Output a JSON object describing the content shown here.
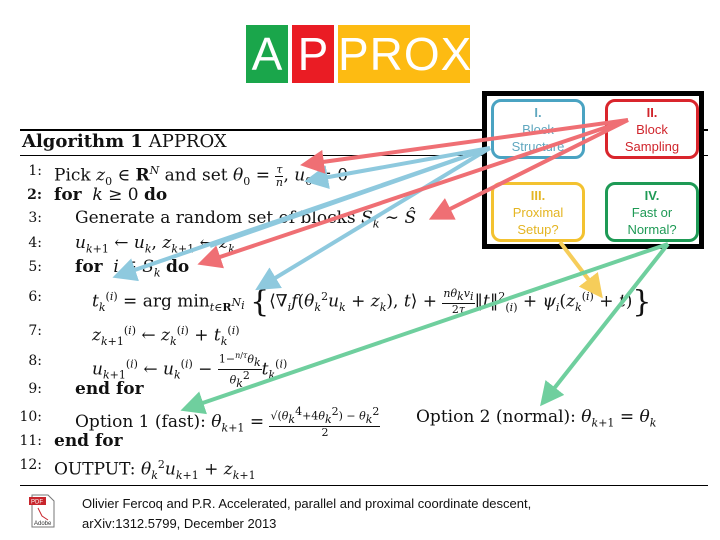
{
  "logo": {
    "tiles": [
      "A",
      "P",
      "PROX"
    ],
    "colors": {
      "a": "#1aa64b",
      "p": "#ea1c24",
      "prox": "#fdbb12"
    }
  },
  "quadrants": [
    {
      "numeral": "I.",
      "lines": [
        "Block",
        "Structure"
      ],
      "color": "#4aa3c2"
    },
    {
      "numeral": "II.",
      "lines": [
        "Block",
        "Sampling"
      ],
      "color": "#d9252c"
    },
    {
      "numeral": "III.",
      "lines": [
        "Proximal",
        "Setup?"
      ],
      "color": "#f3c230"
    },
    {
      "numeral": "IV.",
      "lines": [
        "Fast or",
        "Normal?"
      ],
      "color": "#1e9a55"
    }
  ],
  "algorithm": {
    "title_bold": "Algorithm 1",
    "title_name": "APPROX",
    "lines": [
      {
        "num": "1:",
        "text": "Pick z₀ ∈ Rᴺ and set θ₀ = τ/n, u₀ = 0"
      },
      {
        "num": "2:",
        "text": "for k ≥ 0 do"
      },
      {
        "num": "3:",
        "text": "Generate a random set of blocks Sₖ ∼ Ŝ"
      },
      {
        "num": "4:",
        "text": "uₖ₊₁ ← uₖ, zₖ₊₁ ← zₖ"
      },
      {
        "num": "5:",
        "text": "for i ∈ Sₖ do"
      },
      {
        "num": "6:",
        "text": "tₖ⁽ⁱ⁾ = arg min_{t∈R^{Nᵢ}} { ⟨∇ᵢf(θₖ²uₖ + zₖ), t⟩ + (nθₖvᵢ/2τ)‖t‖²₍ᵢ₎ + ψᵢ(zₖ⁽ⁱ⁾ + t) }"
      },
      {
        "num": "7:",
        "text": "zₖ₊₁⁽ⁱ⁾ ← zₖ⁽ⁱ⁾ + tₖ⁽ⁱ⁾"
      },
      {
        "num": "8:",
        "text": "uₖ₊₁⁽ⁱ⁾ ← uₖ⁽ⁱ⁾ − ((1 − (n/τ)θₖ)/θₖ²) tₖ⁽ⁱ⁾"
      },
      {
        "num": "9:",
        "text": "end for"
      },
      {
        "num": "10:",
        "text": "Option 1 (fast): θₖ₊₁ = (√(θₖ⁴ + 4θₖ²) − θₖ²)/2    Option 2 (normal): θₖ₊₁ = θₖ"
      },
      {
        "num": "11:",
        "text": "end for"
      },
      {
        "num": "12:",
        "text": "OUTPUT: θₖ²uₖ₊₁ + zₖ₊₁"
      }
    ],
    "parts": {
      "l1_pick": "Pick ",
      "l1_and": " and set ",
      "l2_for": "for",
      "l2_do": "do",
      "l3": "Generate a random set of blocks ",
      "l5_for": "for",
      "l5_do": "do",
      "l6_argmin": "arg min",
      "l9": "end for",
      "l10_opt1": "Option 1 (fast): ",
      "l10_opt2": "Option 2 (normal): ",
      "l11": "end for",
      "l12": "OUTPUT: "
    }
  },
  "citation": {
    "line1": "Olivier Fercoq and P.R. Accelerated, parallel and proximal coordinate descent,",
    "line2": "arXiv:1312.5799, December 2013",
    "icon": "pdf-file-icon",
    "icon_label": "PDF"
  },
  "arrow_colors": {
    "blue": "#8ec9de",
    "red": "#ef6f74",
    "yellow": "#f6cd5a",
    "green": "#6fcf9e"
  }
}
